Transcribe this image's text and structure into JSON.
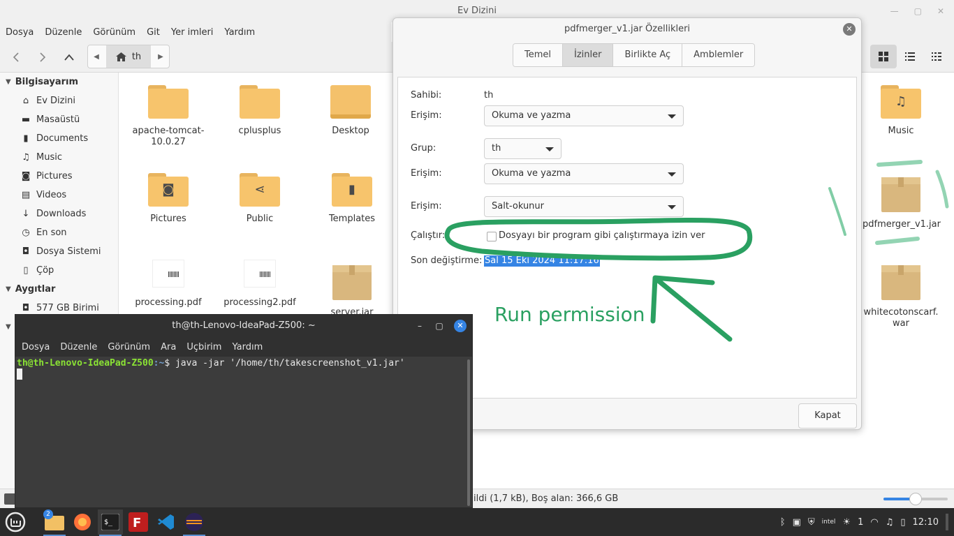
{
  "file_manager": {
    "title": "Ev Dizini",
    "menu": [
      "Dosya",
      "Düzenle",
      "Görünüm",
      "Git",
      "Yer imleri",
      "Yardım"
    ],
    "path_label": "th",
    "sidebar": {
      "section_computer": "Bilgisayarım",
      "items": [
        {
          "label": "Ev Dizini",
          "icon": "home-icon"
        },
        {
          "label": "Masaüstü",
          "icon": "desktop-icon"
        },
        {
          "label": "Documents",
          "icon": "document-icon"
        },
        {
          "label": "Music",
          "icon": "music-icon"
        },
        {
          "label": "Pictures",
          "icon": "camera-icon"
        },
        {
          "label": "Videos",
          "icon": "film-icon"
        },
        {
          "label": "Downloads",
          "icon": "download-icon"
        },
        {
          "label": "En son",
          "icon": "clock-icon"
        },
        {
          "label": "Dosya Sistemi",
          "icon": "drive-icon"
        },
        {
          "label": "Çöp",
          "icon": "trash-icon"
        }
      ],
      "section_devices": "Aygıtlar",
      "devices": [
        {
          "label": "577 GB Birimi",
          "icon": "drive-icon"
        }
      ]
    },
    "files": [
      {
        "name": "apache-tomcat-\n10.0.27",
        "kind": "folder"
      },
      {
        "name": "cplusplus",
        "kind": "folder"
      },
      {
        "name": "Desktop",
        "kind": "folder"
      },
      {
        "name": "Music",
        "kind": "folder-music"
      },
      {
        "name": "Pictures",
        "kind": "folder-pictures"
      },
      {
        "name": "Public",
        "kind": "folder-share"
      },
      {
        "name": "Templates",
        "kind": "folder-templates"
      },
      {
        "name": "pdfmerger_v1.jar",
        "kind": "package"
      },
      {
        "name": "processing.pdf",
        "kind": "pdf"
      },
      {
        "name": "processing2.pdf",
        "kind": "pdf"
      },
      {
        "name": "server.jar",
        "kind": "package"
      },
      {
        "name": "whitecotonscarf.\nwar",
        "kind": "package"
      }
    ],
    "status_text": "ildi (1,7 kB), Boş alan: 366,6 GB",
    "zoom_level": 0.5
  },
  "dialog": {
    "title": "pdfmerger_v1.jar Özellikleri",
    "tabs": [
      "Temel",
      "İzinler",
      "Birlikte Aç",
      "Amblemler"
    ],
    "active_tab": "İzinler",
    "owner_label": "Sahibi:",
    "owner_value": "th",
    "access_label": "Erişim:",
    "owner_access": "Okuma ve yazma",
    "group_label": "Grup:",
    "group_value": "th",
    "group_access": "Okuma ve yazma",
    "others_access": "Salt-okunur",
    "execute_label": "Çalıştır:",
    "execute_checkbox": "Dosyayı bir program gibi çalıştırmaya izin ver",
    "execute_checked": false,
    "modified_label": "Son değiştirme:",
    "modified_value": "Sal 15 Eki 2024 11:17:16",
    "close_button": "Kapat"
  },
  "terminal": {
    "title": "th@th-Lenovo-IdeaPad-Z500: ~",
    "menu": [
      "Dosya",
      "Düzenle",
      "Görünüm",
      "Ara",
      "Uçbirim",
      "Yardım"
    ],
    "prompt_user": "th@th-Lenovo-IdeaPad-Z500",
    "prompt_path": ":~",
    "command": "$ java -jar '/home/th/takescreenshot_v1.jar'"
  },
  "annotation": {
    "text": "Run permission",
    "color": "#2aa061"
  },
  "taskbar": {
    "file_manager_badge": "2",
    "tray_count": "1",
    "clock": "12:10",
    "accent": "#3584e4"
  }
}
